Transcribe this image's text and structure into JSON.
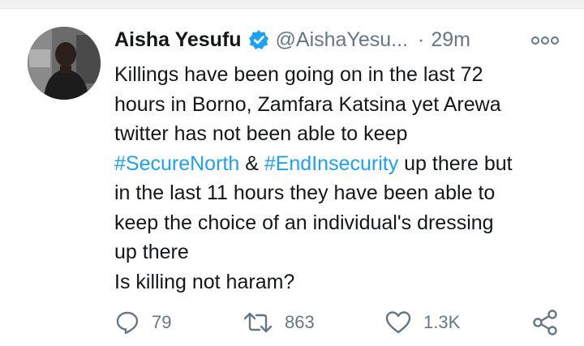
{
  "tweet": {
    "author_name": "Aisha Yesufu",
    "handle": "@AishaYesu...",
    "separator": "·",
    "time": "29m",
    "verified": true,
    "text_lines": [
      [
        {
          "t": "Killings have been going on in the last 72"
        }
      ],
      [
        {
          "t": "hours in Borno, Zamfara Katsina yet Arewa"
        }
      ],
      [
        {
          "t": "twitter has not been able to keep"
        }
      ],
      [
        {
          "t": "#SecureNorth",
          "tag": true
        },
        {
          "t": " & "
        },
        {
          "t": "#EndInsecurity",
          "tag": true
        },
        {
          "t": " up there but"
        }
      ],
      [
        {
          "t": "in the last 11 hours they have been able to"
        }
      ],
      [
        {
          "t": "keep the choice of an individual's dressing"
        }
      ],
      [
        {
          "t": "up there"
        }
      ],
      [
        {
          "t": "Is killing not haram?"
        }
      ]
    ]
  },
  "actions": {
    "reply": {
      "icon": "reply-icon",
      "count": "79"
    },
    "retweet": {
      "icon": "retweet-icon",
      "count": "863"
    },
    "like": {
      "icon": "heart-icon",
      "count": "1.3K"
    },
    "share": {
      "icon": "share-icon"
    }
  },
  "colors": {
    "text": "#14171a",
    "secondary": "#657786",
    "accent": "#1da1f2",
    "verified": "#1da1f2"
  }
}
